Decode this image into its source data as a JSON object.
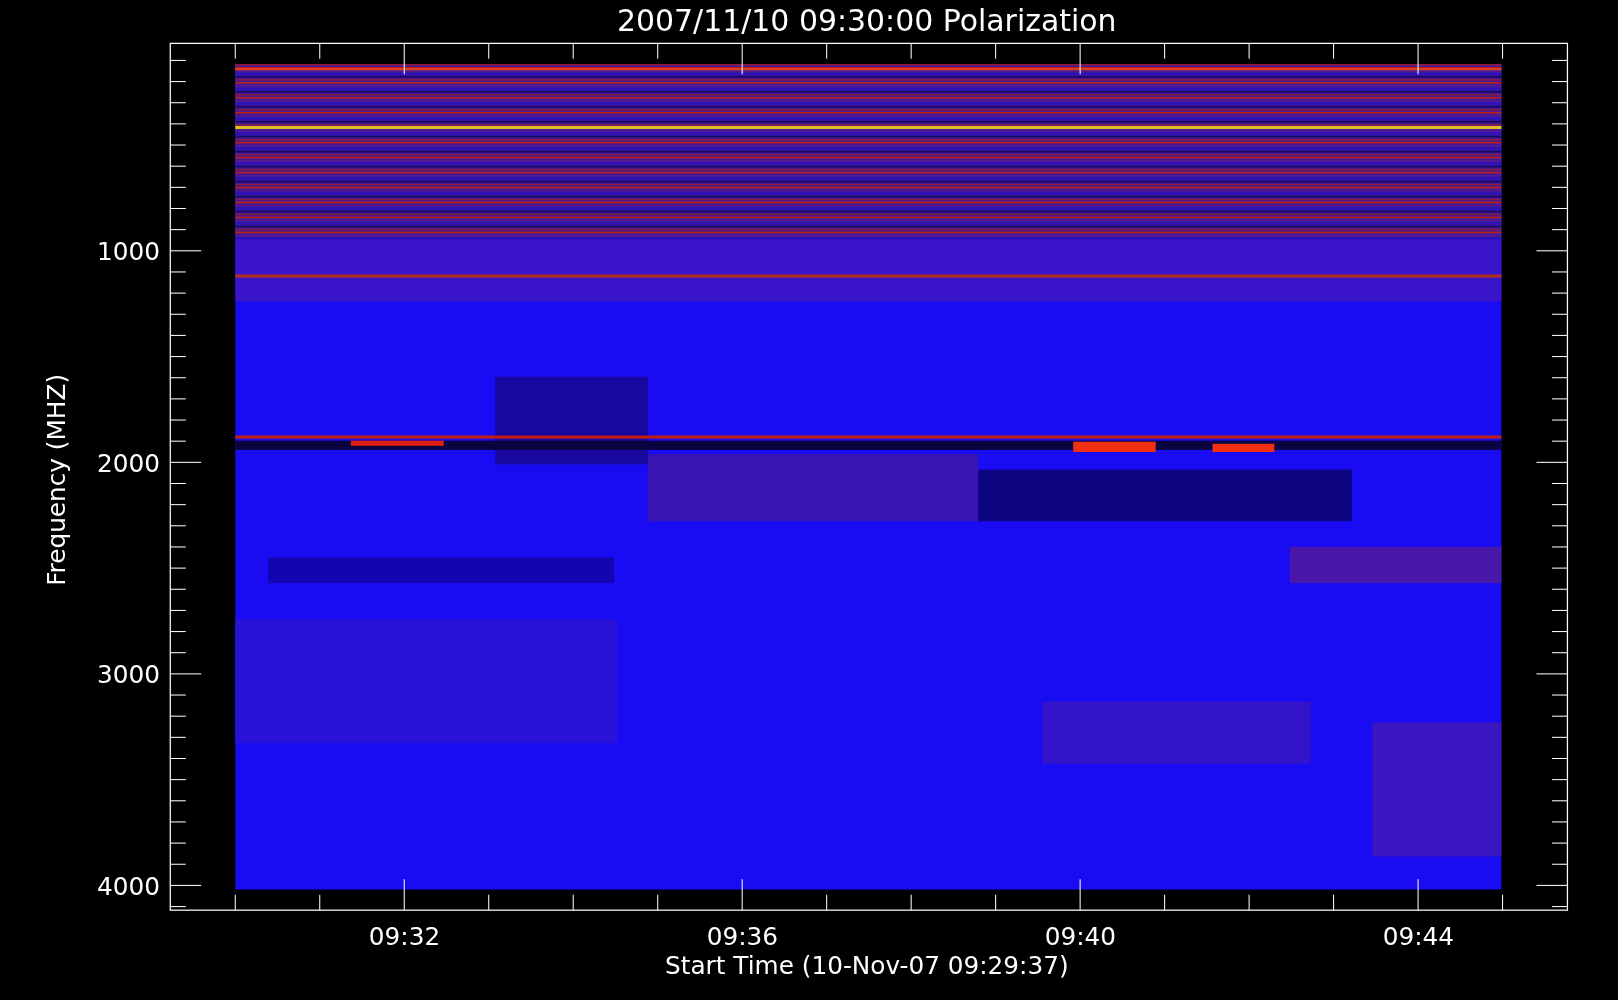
{
  "title": "2007/11/10 09:30:00 Polarization",
  "y_axis": {
    "label": "Frequency (MHZ)",
    "ticks": [
      "1000",
      "2000",
      "3000",
      "4000"
    ]
  },
  "x_axis": {
    "label": "Start Time (10-Nov-07 09:29:37)",
    "ticks": [
      "09:32",
      "09:36",
      "09:40",
      "09:44"
    ]
  }
}
